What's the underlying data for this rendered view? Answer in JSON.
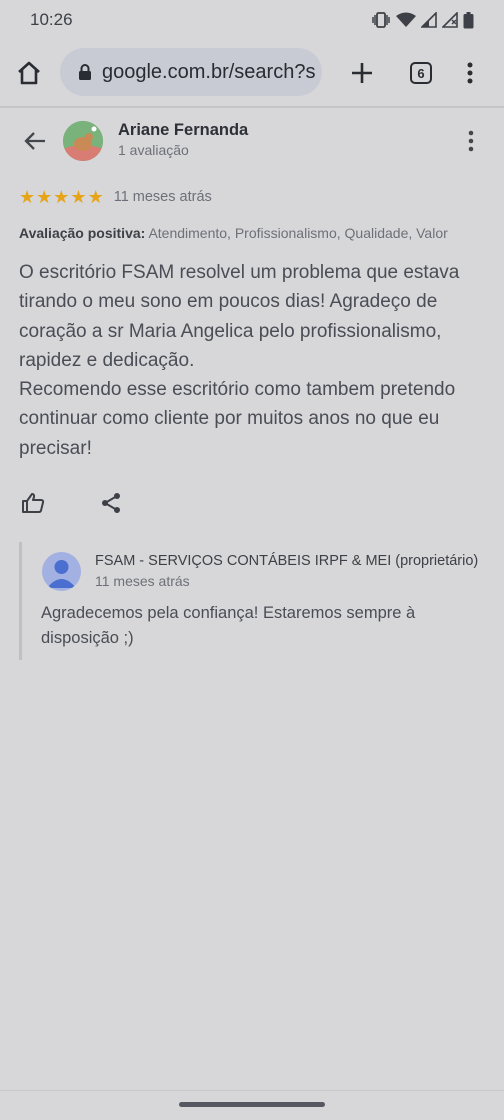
{
  "status_bar": {
    "time": "10:26",
    "icons": [
      "vibrate-icon",
      "wifi-icon",
      "signal-icon",
      "signal-empty-icon",
      "battery-icon"
    ]
  },
  "browser": {
    "url": "google.com.br/search?s",
    "tab_count": "6",
    "icons": [
      "home-icon",
      "lock-icon",
      "plus-icon",
      "tabs-icon",
      "more-vert-icon"
    ]
  },
  "review": {
    "reviewer_name": "Ariane Fernanda",
    "reviewer_meta": "1 avaliação",
    "stars": 5,
    "date": "11 meses atrás",
    "positive_label": "Avaliação positiva:",
    "positive_items": "Atendimento, Profissionalismo, Qualidade, Valor",
    "text_p1": "O escritório FSAM resolvel um problema que estava tirando o meu sono em poucos dias! Agradeço de coração a sr Maria Angelica pelo profissionalismo, rapidez e dedicação.",
    "text_p2": "Recomendo esse escritório como tambem pretendo continuar como cliente por muitos anos no que eu precisar!"
  },
  "reply": {
    "owner_name": "FSAM - SERVIÇOS CONTÁBEIS IRPF & MEI (proprietário)",
    "date": "11 meses atrás",
    "text": "Agradecemos pela confiança! Estaremos sempre à disposição ;)"
  },
  "colors": {
    "background": "#d7d7d9",
    "url_bar": "#c9cbd4",
    "star": "#e6a419",
    "owner_avatar": "#a3b1e2"
  }
}
